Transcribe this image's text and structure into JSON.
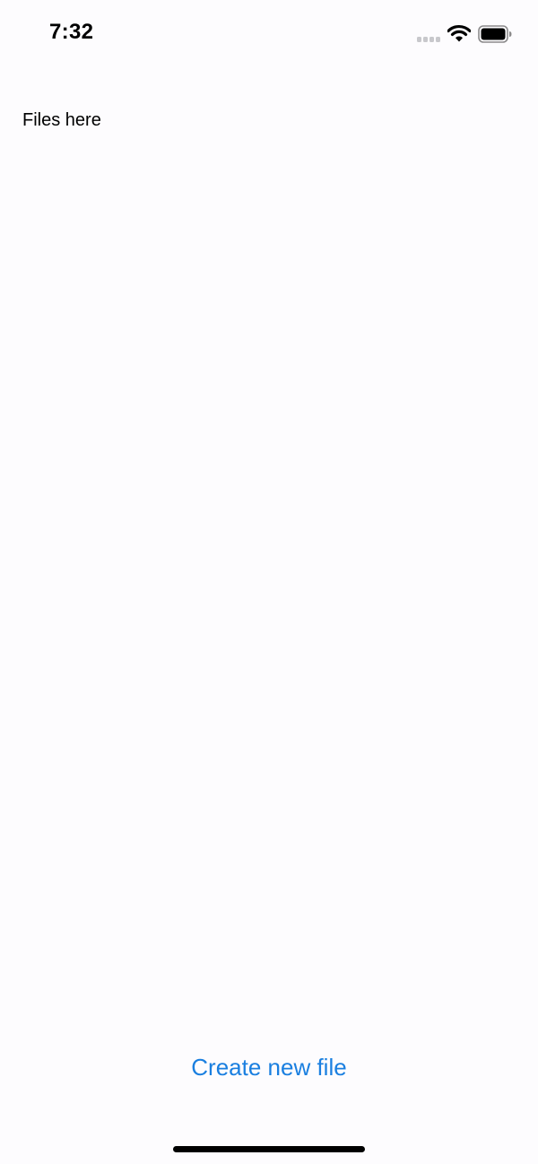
{
  "status_bar": {
    "time": "7:32",
    "icons": [
      "cellular-signal-icon",
      "wifi-icon",
      "battery-icon"
    ]
  },
  "main": {
    "placeholder_text": "Files here"
  },
  "actions": {
    "create_label": "Create new file"
  },
  "colors": {
    "accent": "#1a7fe0",
    "background": "#fdfcfe",
    "text": "#000000"
  }
}
